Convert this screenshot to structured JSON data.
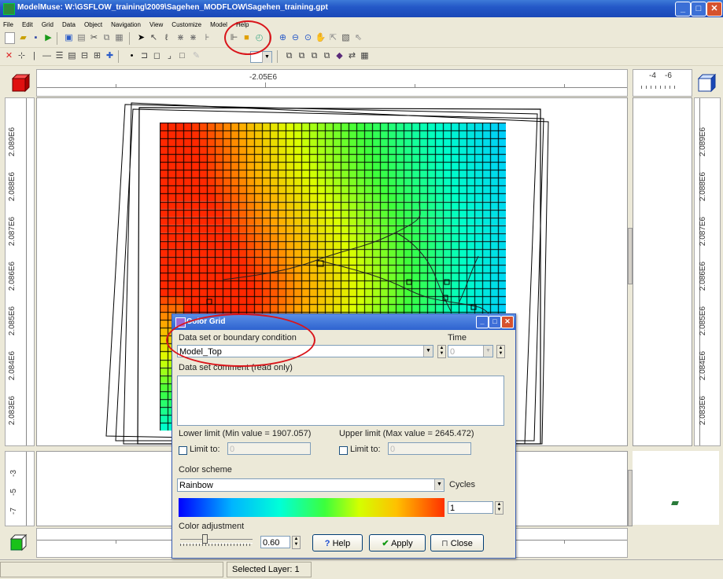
{
  "window": {
    "title": "ModelMuse: W:\\GSFLOW_training\\2009\\Sagehen_MODFLOW\\Sagehen_training.gpt",
    "min": "_",
    "max": "□",
    "close": "✕"
  },
  "menu": [
    "File",
    "Edit",
    "Grid",
    "Data",
    "Object",
    "Navigation",
    "View",
    "Customize",
    "Model",
    "Help"
  ],
  "rulers": {
    "top_label": "-2.05E6",
    "side_top_labels": [
      "-4",
      "-6"
    ],
    "left_labels": [
      "2.089E6",
      "2.088E6",
      "2.087E6",
      "2.086E6",
      "2.085E6",
      "2.084E6",
      "2.083E6"
    ],
    "right_labels": [
      "2.089E6",
      "2.088E6",
      "2.087E6",
      "2.086E6",
      "2.085E6",
      "2.084E6",
      "2.083E6"
    ],
    "front_labels": [
      "-3",
      "-5",
      "-7"
    ]
  },
  "status": {
    "selected_layer": "Selected Layer: 1"
  },
  "dialog": {
    "title": "Color Grid",
    "dataset_label": "Data set or boundary condition",
    "dataset_value": "Model_Top",
    "time_label": "Time",
    "time_value": "0",
    "comment_label": "Data set comment (read only)",
    "lower_limit_label": "Lower limit (Min value = 1907.057)",
    "upper_limit_label": "Upper limit (Max value = 2645.472)",
    "limit_to_label": "Limit to:",
    "lower_limit_value": "0",
    "upper_limit_value": "0",
    "color_scheme_label": "Color scheme",
    "color_scheme_value": "Rainbow",
    "cycles_label": "Cycles",
    "cycles_value": "1",
    "color_adjustment_label": "Color adjustment",
    "color_adjustment_value": "0.60",
    "help_button": "Help",
    "apply_button": "Apply",
    "close_button": "Close"
  },
  "colors": {
    "highlight": "#d9151b",
    "title_blue": "#2458c7",
    "face": "#ece9d8"
  }
}
